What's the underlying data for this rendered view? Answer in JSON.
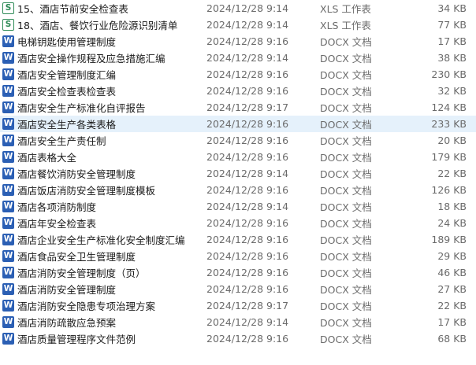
{
  "files": [
    {
      "icon": "excel-icon",
      "icon_letter": "S",
      "name": "15、酒店节前安全检查表",
      "date": "2024/12/28 9:14",
      "type": "XLS 工作表",
      "size": "34 KB"
    },
    {
      "icon": "excel-icon",
      "icon_letter": "S",
      "name": "18、酒店、餐饮行业危险源识别清单",
      "date": "2024/12/28 9:14",
      "type": "XLS 工作表",
      "size": "77 KB"
    },
    {
      "icon": "word-icon",
      "icon_letter": "W",
      "name": "电梯钥匙使用管理制度",
      "date": "2024/12/28 9:16",
      "type": "DOCX 文档",
      "size": "17 KB"
    },
    {
      "icon": "word-icon",
      "icon_letter": "W",
      "name": "酒店安全操作规程及应急措施汇编",
      "date": "2024/12/28 9:14",
      "type": "DOCX 文档",
      "size": "38 KB"
    },
    {
      "icon": "word-icon",
      "icon_letter": "W",
      "name": "酒店安全管理制度汇编",
      "date": "2024/12/28 9:16",
      "type": "DOCX 文档",
      "size": "230 KB"
    },
    {
      "icon": "word-icon",
      "icon_letter": "W",
      "name": "酒店安全检查表检查表",
      "date": "2024/12/28 9:16",
      "type": "DOCX 文档",
      "size": "32 KB"
    },
    {
      "icon": "word-icon",
      "icon_letter": "W",
      "name": "酒店安全生产标准化自评报告",
      "date": "2024/12/28 9:17",
      "type": "DOCX 文档",
      "size": "124 KB"
    },
    {
      "icon": "word-icon",
      "icon_letter": "W",
      "name": "酒店安全生产各类表格",
      "date": "2024/12/28 9:16",
      "type": "DOCX 文档",
      "size": "233 KB",
      "selected": true
    },
    {
      "icon": "word-icon",
      "icon_letter": "W",
      "name": "酒店安全生产责任制",
      "date": "2024/12/28 9:16",
      "type": "DOCX 文档",
      "size": "20 KB"
    },
    {
      "icon": "word-icon",
      "icon_letter": "W",
      "name": "酒店表格大全",
      "date": "2024/12/28 9:16",
      "type": "DOCX 文档",
      "size": "179 KB"
    },
    {
      "icon": "word-icon",
      "icon_letter": "W",
      "name": "酒店餐饮消防安全管理制度",
      "date": "2024/12/28 9:14",
      "type": "DOCX 文档",
      "size": "22 KB"
    },
    {
      "icon": "word-icon",
      "icon_letter": "W",
      "name": "酒店饭店消防安全管理制度模板",
      "date": "2024/12/28 9:16",
      "type": "DOCX 文档",
      "size": "126 KB"
    },
    {
      "icon": "word-icon",
      "icon_letter": "W",
      "name": "酒店各项消防制度",
      "date": "2024/12/28 9:14",
      "type": "DOCX 文档",
      "size": "18 KB"
    },
    {
      "icon": "word-icon",
      "icon_letter": "W",
      "name": "酒店年安全检查表",
      "date": "2024/12/28 9:16",
      "type": "DOCX 文档",
      "size": "24 KB"
    },
    {
      "icon": "word-icon",
      "icon_letter": "W",
      "name": "酒店企业安全生产标准化安全制度汇编",
      "date": "2024/12/28 9:16",
      "type": "DOCX 文档",
      "size": "189 KB"
    },
    {
      "icon": "word-icon",
      "icon_letter": "W",
      "name": "酒店食品安全卫生管理制度",
      "date": "2024/12/28 9:16",
      "type": "DOCX 文档",
      "size": "29 KB"
    },
    {
      "icon": "word-icon",
      "icon_letter": "W",
      "name": "酒店消防安全管理制度（页）",
      "date": "2024/12/28 9:16",
      "type": "DOCX 文档",
      "size": "46 KB"
    },
    {
      "icon": "word-icon",
      "icon_letter": "W",
      "name": "酒店消防安全管理制度",
      "date": "2024/12/28 9:16",
      "type": "DOCX 文档",
      "size": "27 KB"
    },
    {
      "icon": "word-icon",
      "icon_letter": "W",
      "name": "酒店消防安全隐患专项治理方案",
      "date": "2024/12/28 9:17",
      "type": "DOCX 文档",
      "size": "22 KB"
    },
    {
      "icon": "word-icon",
      "icon_letter": "W",
      "name": "酒店消防疏散应急预案",
      "date": "2024/12/28 9:14",
      "type": "DOCX 文档",
      "size": "17 KB"
    },
    {
      "icon": "word-icon",
      "icon_letter": "W",
      "name": "酒店质量管理程序文件范例",
      "date": "2024/12/28 9:16",
      "type": "DOCX 文档",
      "size": "68 KB"
    }
  ]
}
